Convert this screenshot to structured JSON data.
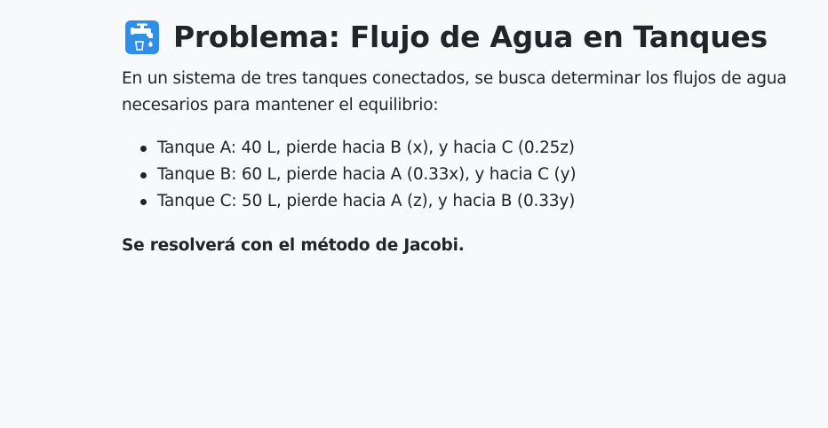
{
  "header": {
    "icon": "water-tap-icon",
    "title": "Problema: Flujo de Agua en Tanques"
  },
  "intro": "En un sistema de tres tanques conectados, se busca determinar los flujos de agua necesarios para mantener el equilibrio:",
  "tanks": [
    "Tanque A: 40 L, pierde hacia B (x), y hacia C (0.25z)",
    "Tanque B: 60 L, pierde hacia A (0.33x), y hacia C (y)",
    "Tanque C: 50 L, pierde hacia A (z), y hacia B (0.33y)"
  ],
  "conclusion": "Se resolverá con el método de Jacobi.",
  "colors": {
    "background": "#f8f9fb",
    "text": "#212529",
    "icon_blue": "#2f8fe8"
  }
}
